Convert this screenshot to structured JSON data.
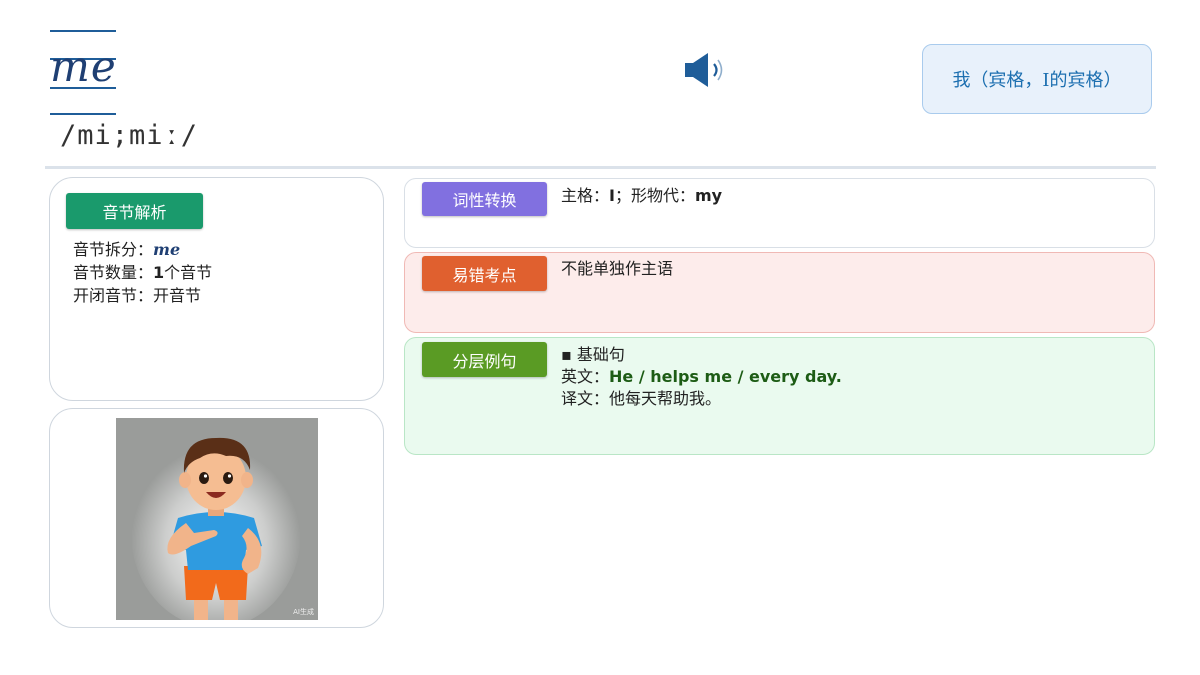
{
  "header": {
    "word": "me",
    "phonetic": "/mi;miː/",
    "meaning": "我（宾格，I的宾格）"
  },
  "syllable": {
    "badge": "音节解析",
    "badge_color": "#1a9a6c",
    "split_label": "音节拆分：",
    "split_value": "me",
    "count_label": "音节数量：",
    "count_value": "1",
    "count_suffix": "个音节",
    "type_label": "开闭音节：",
    "type_value": "开音节"
  },
  "image": {
    "watermark": "AI生成"
  },
  "panels": {
    "pos": {
      "badge": "词性转换",
      "badge_color": "#8170e0",
      "label1": "主格：",
      "val1": "I",
      "sep": "；形物代：",
      "val2": "my"
    },
    "mistake": {
      "badge": "易错考点",
      "badge_color": "#e0602f",
      "text": "不能单独作主语"
    },
    "examples": {
      "badge": "分层例句",
      "badge_color": "#5a9b24",
      "level": "▪ 基础句",
      "en_label": "英文：",
      "en": "He / helps me / every day.",
      "zh_label": "译文：",
      "zh": "他每天帮助我。"
    }
  },
  "colors": {
    "accent": "#1f5d99",
    "meaning_text": "#1c6fb0"
  },
  "icons": {
    "speaker": "speaker-icon"
  }
}
